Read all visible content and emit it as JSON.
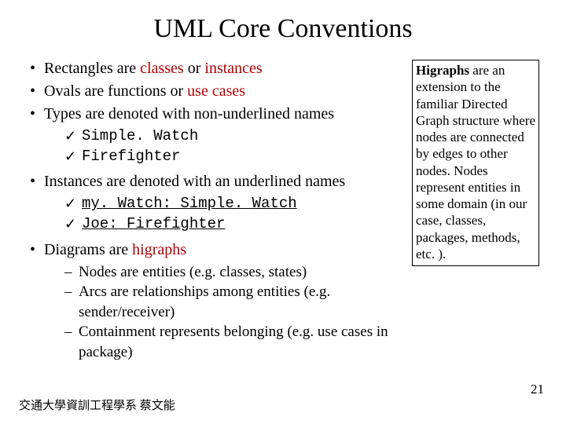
{
  "title": "UML Core Conventions",
  "bullets": {
    "b1_pre": "Rectangles are ",
    "b1_red1": "classes",
    "b1_mid": " or ",
    "b1_red2": "instances",
    "b2_pre": "Ovals are functions or ",
    "b2_red": "use cases",
    "b3": "Types are denoted with non-underlined names",
    "b3_sub1": "Simple. Watch",
    "b3_sub2": "Firefighter",
    "b4": "Instances are denoted with an underlined names",
    "b4_sub1": "my. Watch: Simple. Watch",
    "b4_sub2": "Joe: Firefighter",
    "b5_pre": "Diagrams are ",
    "b5_red": "higraphs",
    "b5_sub1": "Nodes are entities (e.g. classes, states)",
    "b5_sub2": "Arcs are relationships among entities (e.g. sender/receiver)",
    "b5_sub3": "Containment represents belonging (e.g. use cases in package)"
  },
  "sidebox": {
    "bold": "Higraphs",
    "rest": " are an extension to the familiar Directed Graph structure where nodes are connected by edges to other nodes. Nodes represent entities in some domain (in our case, classes, packages, methods, etc. )."
  },
  "footer_left": "交通大學資訓工程學系 蔡文能",
  "footer_right": "21"
}
